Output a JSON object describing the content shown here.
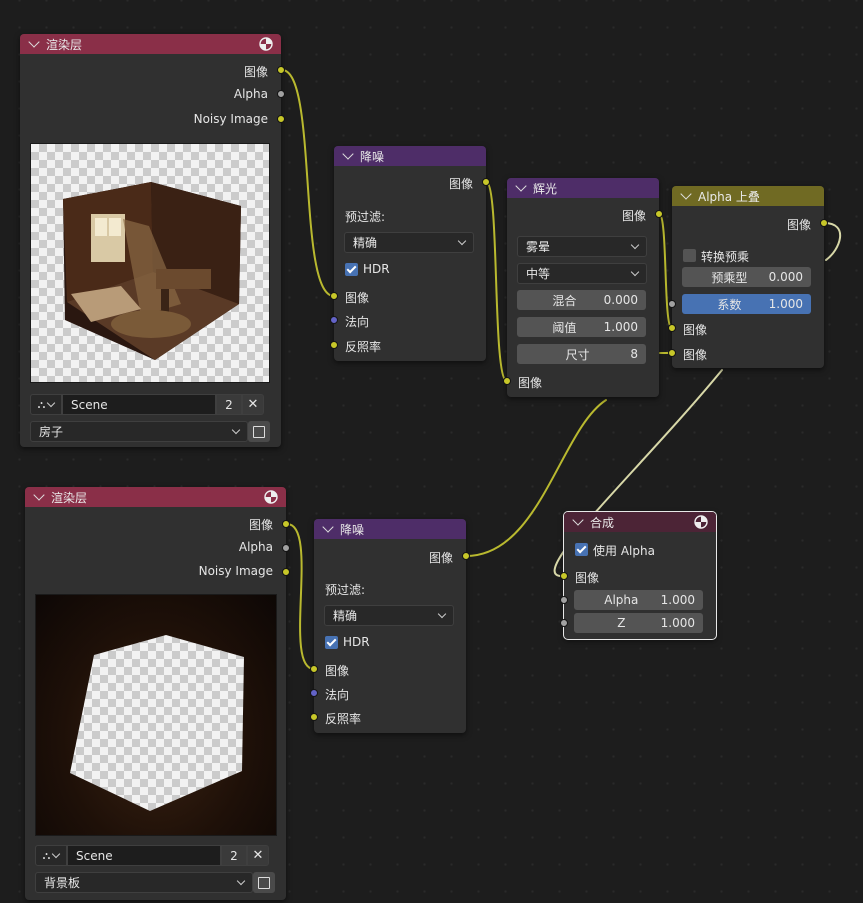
{
  "render_layers_1": {
    "title": "渲染层",
    "outputs": [
      "图像",
      "Alpha",
      "Noisy Image"
    ],
    "scene": "Scene",
    "users": "2",
    "view_layer": "房子"
  },
  "render_layers_2": {
    "title": "渲染层",
    "outputs": [
      "图像",
      "Alpha",
      "Noisy Image"
    ],
    "scene": "Scene",
    "users": "2",
    "view_layer": "背景板"
  },
  "denoise_1": {
    "title": "降噪",
    "output": "图像",
    "prefilter_label": "预过滤:",
    "prefilter_value": "精确",
    "hdr_label": "HDR",
    "hdr_checked": true,
    "inputs": [
      "图像",
      "法向",
      "反照率"
    ]
  },
  "denoise_2": {
    "title": "降噪",
    "output": "图像",
    "prefilter_label": "预过滤:",
    "prefilter_value": "精确",
    "hdr_label": "HDR",
    "hdr_checked": true,
    "inputs": [
      "图像",
      "法向",
      "反照率"
    ]
  },
  "glare": {
    "title": "辉光",
    "output": "图像",
    "type_value": "雾晕",
    "quality_value": "中等",
    "mix_label": "混合",
    "mix_value": "0.000",
    "threshold_label": "阈值",
    "threshold_value": "1.000",
    "size_label": "尺寸",
    "size_value": "8",
    "input": "图像"
  },
  "alpha_over": {
    "title": "Alpha 上叠",
    "output": "图像",
    "convert_premul_label": "转换预乘",
    "premul_label": "预乘型",
    "premul_value": "0.000",
    "fac_label": "系数",
    "fac_value": "1.000",
    "inputs": [
      "图像",
      "图像"
    ]
  },
  "composite": {
    "title": "合成",
    "use_alpha_label": "使用 Alpha",
    "use_alpha_checked": true,
    "input_image": "图像",
    "alpha_label": "Alpha",
    "alpha_value": "1.000",
    "z_label": "Z",
    "z_value": "1.000"
  },
  "colors": {
    "render_layer_header": "#8a2f48",
    "filter_header": "#4e2d68",
    "mix_header": "#706a23",
    "output_header": "#4c2436",
    "node_body": "#303030",
    "socket_color": "#c7c729",
    "socket_value": "#a1a1a1",
    "socket_vector": "#6363c7",
    "active_field": "#4772b3",
    "wire_color": "#b9b92f",
    "wire_selected": "#d8d8a8"
  }
}
